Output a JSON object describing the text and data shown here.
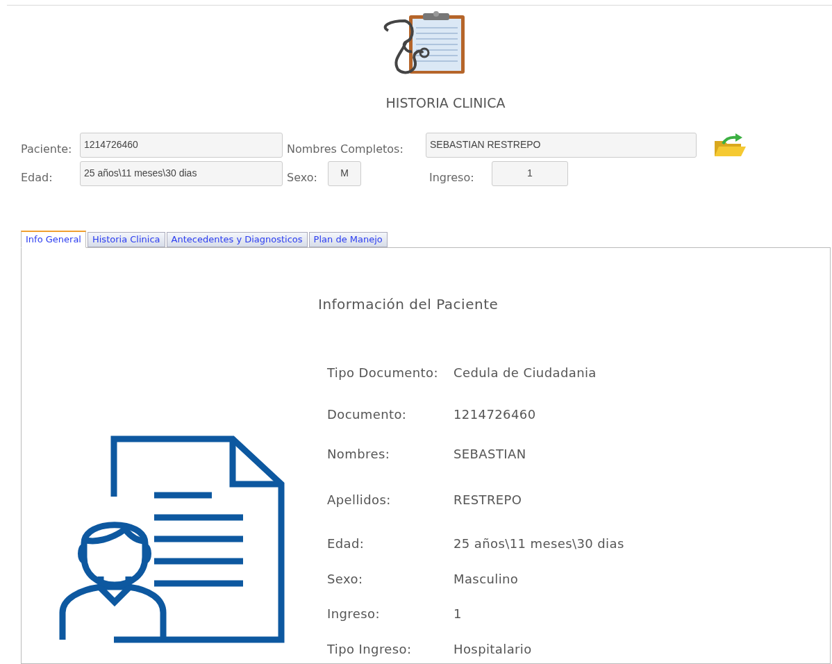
{
  "title": "HISTORIA CLINICA",
  "header_fields": [
    {
      "label": "Paciente:",
      "value": "1214726460"
    },
    {
      "label": "Nombres Completos:",
      "value": "SEBASTIAN RESTREPO"
    },
    {
      "label": "Edad:",
      "value": "25 años\\11 meses\\30 dias"
    },
    {
      "label": "Sexo:",
      "value": "M"
    },
    {
      "label": "Ingreso:",
      "value": "1"
    }
  ],
  "tabs": [
    {
      "label": "Info General",
      "selected": true
    },
    {
      "label": "Historia Clinica",
      "selected": false
    },
    {
      "label": "Antecedentes y Diagnosticos",
      "selected": false
    },
    {
      "label": "Plan de Manejo",
      "selected": false
    }
  ],
  "panel": {
    "heading": "Información del Paciente",
    "rows": [
      {
        "label": "Tipo Documento:",
        "value": "Cedula de Ciudadania"
      },
      {
        "label": "Documento:",
        "value": "1214726460"
      },
      {
        "label": "Nombres:",
        "value": "SEBASTIAN"
      },
      {
        "label": "Apellidos:",
        "value": "RESTREPO"
      },
      {
        "label": "Edad:",
        "value": "25 años\\11 meses\\30 dias"
      },
      {
        "label": "Sexo:",
        "value": "Masculino"
      },
      {
        "label": "Ingreso:",
        "value": "1"
      },
      {
        "label": "Tipo Ingreso:",
        "value": "Hospitalario"
      }
    ]
  }
}
